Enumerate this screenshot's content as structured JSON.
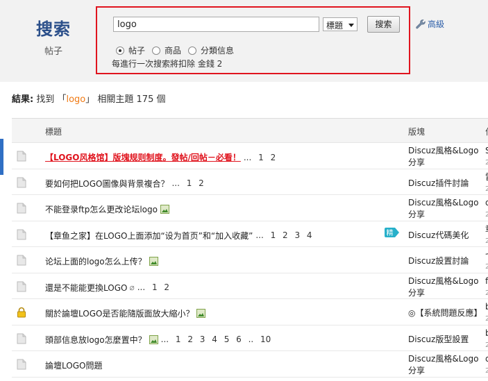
{
  "brand": {
    "title": "搜索",
    "subtitle": "帖子"
  },
  "search": {
    "query": "logo",
    "type_selected": "標題",
    "button_label": "搜索",
    "options": [
      {
        "label": "帖子",
        "checked": true
      },
      {
        "label": "商品",
        "checked": false
      },
      {
        "label": "分類信息",
        "checked": false
      }
    ],
    "note": "每進行一次搜索將扣除 金錢 2"
  },
  "advanced": {
    "label": "高級",
    "icon": "wrench-icon"
  },
  "results": {
    "prefix": "結果:",
    "found": "找到 「",
    "keyword": "logo",
    "suffix": "」 相關主題 175 個"
  },
  "table": {
    "headers": {
      "title": "標題",
      "forum": "版塊",
      "author": "作"
    },
    "rows": [
      {
        "title": "【LOGO风格馆】版塊规则制度。發帖/回帖－必看！",
        "pages": "... 1 2",
        "forum": "Discuz風格&Logo分享",
        "author": "S",
        "author_sub": "2",
        "icon": "thread-icon",
        "hot": true
      },
      {
        "title": "要如何把LOGO圖像與背景複合？",
        "pages": "... 1 2",
        "forum": "Discuz插件討論",
        "author": "雷",
        "author_sub": "2",
        "icon": "thread-icon"
      },
      {
        "title": "不能登录ftp怎么更改论坛logo",
        "pages": "",
        "forum": "Discuz風格&Logo分享",
        "author": "d",
        "author_sub": "2",
        "icon": "thread-icon",
        "image": true
      },
      {
        "title": "【章鱼之家】在LOGO上面添加“设为首页”和“加入收藏”",
        "pages": "... 1 2 3 4",
        "forum": "Discuz代碼美化",
        "author": "章",
        "author_sub": "2",
        "icon": "thread-icon",
        "digest": true
      },
      {
        "title": "论坛上面的logo怎么上传？",
        "pages": "",
        "forum": "Discuz設置討論",
        "author": "七",
        "author_sub": "2",
        "icon": "thread-icon",
        "image": true
      },
      {
        "title": "還是不能能更換LOGO",
        "pages": "... 1 2",
        "forum": "Discuz風格&Logo分享",
        "author": "f",
        "author_sub": "2",
        "icon": "thread-icon",
        "attach": true
      },
      {
        "title": "關於論壇LOGO是否能隨版面放大縮小？",
        "pages": "",
        "forum": "◎【系統問題反應】",
        "author": "b",
        "author_sub": "2",
        "icon": "lock-icon",
        "image": true
      },
      {
        "title": "頭部信息放logo怎麼置中？",
        "pages": "... 1 2 3 4 5 6 .. 10",
        "forum": "Discuz版型設置",
        "author": "b",
        "author_sub": "2",
        "icon": "thread-icon",
        "image": true
      },
      {
        "title": "論壇LOGO問題",
        "pages": "",
        "forum": "Discuz風格&Logo分享",
        "author": "d",
        "author_sub": "2",
        "icon": "thread-icon"
      }
    ]
  }
}
